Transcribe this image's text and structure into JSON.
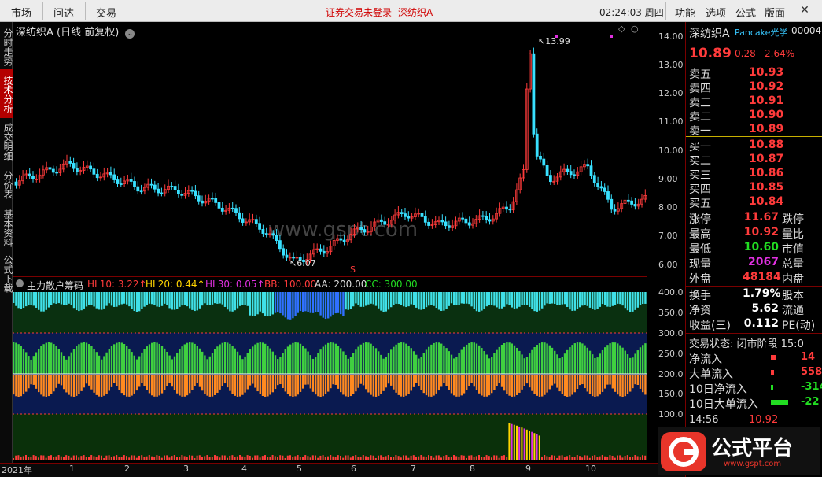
{
  "menu": {
    "market": "市场",
    "wenda": "问达",
    "trade": "交易",
    "warning": "证券交易未登录",
    "stock_tab": "深纺织A",
    "time": "02:24:03 周四",
    "function": "功能",
    "options": "选项",
    "formula": "公式",
    "layout": "版面"
  },
  "sidebar_tabs": [
    "分时走势",
    "技术分析",
    "成交明细",
    "分价表",
    "基本资料",
    "公式下载"
  ],
  "chart": {
    "title": "深纺织A (日线 前复权)",
    "watermark": "www.gspt.com",
    "high_label": "13.99",
    "low_label": "6.07",
    "y_ticks": [
      "14.00",
      "13.00",
      "12.00",
      "11.00",
      "10.00",
      "9.00",
      "8.00",
      "7.00",
      "6.00"
    ]
  },
  "indicator": {
    "name": "主力散户筹码",
    "items": [
      {
        "text": "HL10: 3.22↑",
        "color": "#ff3b3b"
      },
      {
        "text": "HL20: 0.44↑",
        "color": "#ffd400"
      },
      {
        "text": "HL30: 0.05↑",
        "color": "#e030e0"
      },
      {
        "text": "BB: 100.00",
        "color": "#ff3b3b"
      },
      {
        "text": "AA: 200.00",
        "color": "#dddddd"
      },
      {
        "text": "CC: 300.00",
        "color": "#22dd22"
      }
    ],
    "y_ticks": [
      "400.0",
      "350.0",
      "300.0",
      "250.0",
      "200.0",
      "150.0",
      "100.0"
    ]
  },
  "x_axis": {
    "labels": [
      "2021年",
      "1",
      "2",
      "3",
      "4",
      "5",
      "6",
      "7",
      "8",
      "9",
      "10"
    ]
  },
  "quote": {
    "name": "深纺织A",
    "code": "00004",
    "pancake": "Pancake光学",
    "price": "10.89",
    "change": "0.28",
    "change_pct": "2.64%",
    "asks": [
      {
        "label": "卖五",
        "price": "10.93"
      },
      {
        "label": "卖四",
        "price": "10.92"
      },
      {
        "label": "卖三",
        "price": "10.91"
      },
      {
        "label": "卖二",
        "price": "10.90"
      },
      {
        "label": "卖一",
        "price": "10.89"
      }
    ],
    "bids": [
      {
        "label": "买一",
        "price": "10.88"
      },
      {
        "label": "买二",
        "price": "10.87"
      },
      {
        "label": "买三",
        "price": "10.86"
      },
      {
        "label": "买四",
        "price": "10.85"
      },
      {
        "label": "买五",
        "price": "10.84"
      }
    ],
    "stats": [
      {
        "label": "涨停",
        "value": "11.67",
        "label2": "跌停",
        "color": "#ff3b3b"
      },
      {
        "label": "最高",
        "value": "10.92",
        "label2": "量比",
        "color": "#ff3b3b"
      },
      {
        "label": "最低",
        "value": "10.60",
        "label2": "市值",
        "color": "#22dd22"
      },
      {
        "label": "现量",
        "value": "2067",
        "label2": "总量",
        "color": "#e030e0"
      },
      {
        "label": "外盘",
        "value": "48184",
        "label2": "内盘",
        "color": "#ff3b3b"
      }
    ],
    "stats2": [
      {
        "label": "换手",
        "value": "1.79%",
        "label2": "股本"
      },
      {
        "label": "净资",
        "value": "5.62",
        "label2": "流通"
      },
      {
        "label": "收益(三)",
        "value": "0.112",
        "label2": "PE(动)"
      }
    ],
    "trade_status": "交易状态: 闭市阶段 15:0",
    "flows": [
      {
        "label": "净流入",
        "value": "14",
        "color": "#ff3b3b"
      },
      {
        "label": "大单流入",
        "value": "558",
        "color": "#ff3b3b"
      },
      {
        "label": "10日净流入",
        "value": "-314",
        "color": "#22dd22"
      },
      {
        "label": "10日大单流入",
        "value": "-22",
        "color": "#22dd22"
      }
    ],
    "tick_time": "14:56",
    "tick_price": "10.92"
  },
  "logo": {
    "text": "公式平台",
    "url": "www.gspt.com"
  }
}
